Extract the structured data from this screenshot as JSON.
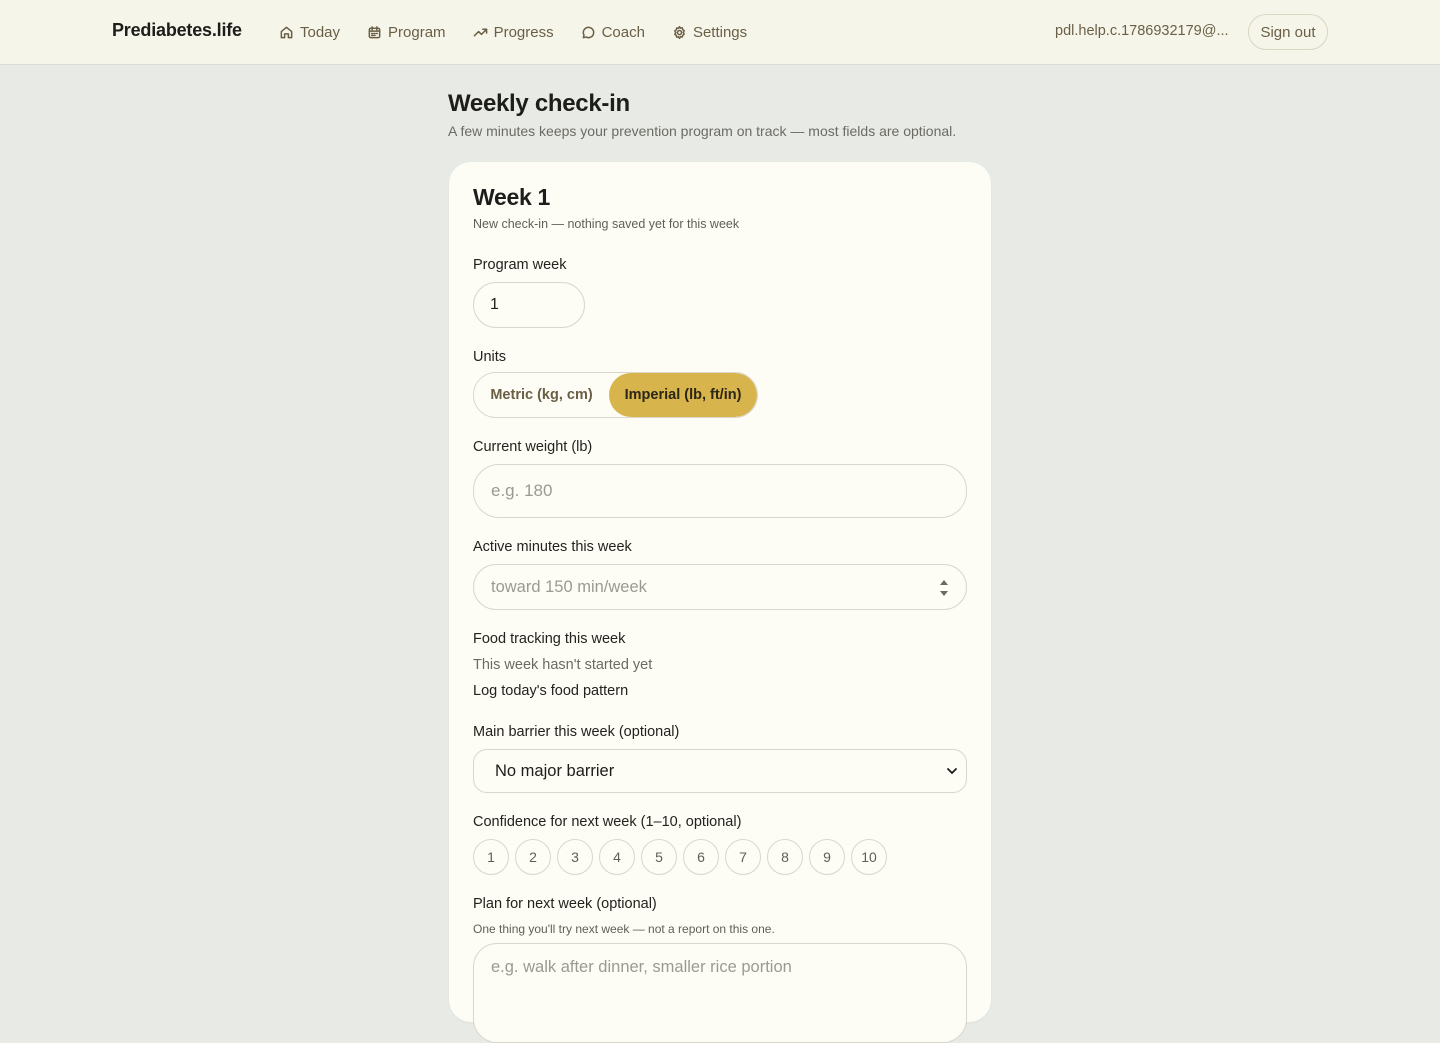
{
  "header": {
    "brand": "Prediabetes.life",
    "nav": [
      {
        "label": "Today",
        "icon": "home-icon"
      },
      {
        "label": "Program",
        "icon": "calendar-icon"
      },
      {
        "label": "Progress",
        "icon": "trend-icon"
      },
      {
        "label": "Coach",
        "icon": "chat-bubble-icon"
      },
      {
        "label": "Settings",
        "icon": "gear-icon"
      }
    ],
    "user_email": "pdl.help.c.1786932179@...",
    "sign_out": "Sign out"
  },
  "page": {
    "title": "Weekly check-in",
    "subtitle": "A few minutes keeps your prevention program on track — most fields are optional."
  },
  "card": {
    "week_title": "Week 1",
    "week_status": "New check-in — nothing saved yet for this week",
    "program_week": {
      "label": "Program week",
      "value": "1"
    },
    "units": {
      "label": "Units",
      "options": [
        "Metric (kg, cm)",
        "Imperial (lb, ft/in)"
      ],
      "selected": "Imperial (lb, ft/in)"
    },
    "weight": {
      "label": "Current weight (lb)",
      "placeholder": "e.g. 180"
    },
    "active_minutes": {
      "label": "Active minutes this week",
      "placeholder": "toward 150 min/week"
    },
    "food_tracking": {
      "label": "Food tracking this week",
      "status": "This week hasn't started yet",
      "action": "Log today's food pattern"
    },
    "barrier": {
      "label": "Main barrier this week (optional)",
      "value": "No major barrier"
    },
    "confidence": {
      "label": "Confidence for next week (1–10, optional)",
      "options": [
        "1",
        "2",
        "3",
        "4",
        "5",
        "6",
        "7",
        "8",
        "9",
        "10"
      ]
    },
    "plan": {
      "label": "Plan for next week (optional)",
      "hint": "One thing you'll try next week — not a report on this one.",
      "placeholder": "e.g. walk after dinner, smaller rice portion"
    }
  },
  "colors": {
    "accent": "#d8b44c",
    "nav_text": "#6a5f45",
    "background": "#e8eae5",
    "card": "#fdfcf5"
  }
}
